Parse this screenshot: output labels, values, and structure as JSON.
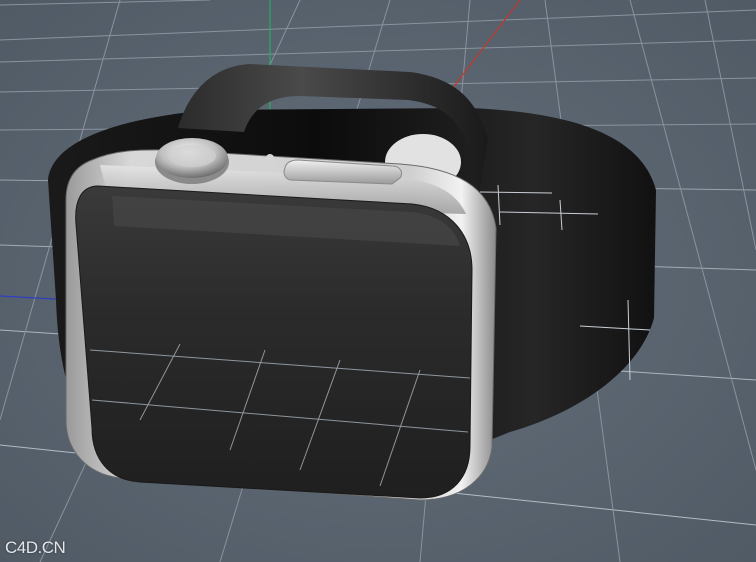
{
  "viewport": {
    "watermark": "C4D.CN",
    "background_color": "#5a6470",
    "grid_line_color": "#c9cfd6",
    "grid_line_color_soft": "#8a939d"
  },
  "axes": {
    "x_axis_color": "#c0392b",
    "y_axis_color": "#27ae60",
    "z_axis_color": "#2e3fbf"
  },
  "model": {
    "name": "smartwatch",
    "band_color": "#151515",
    "case_color": "#c6c6c6",
    "screen_color": "#2a2a2a",
    "crown_color": "#bfbfbf"
  }
}
